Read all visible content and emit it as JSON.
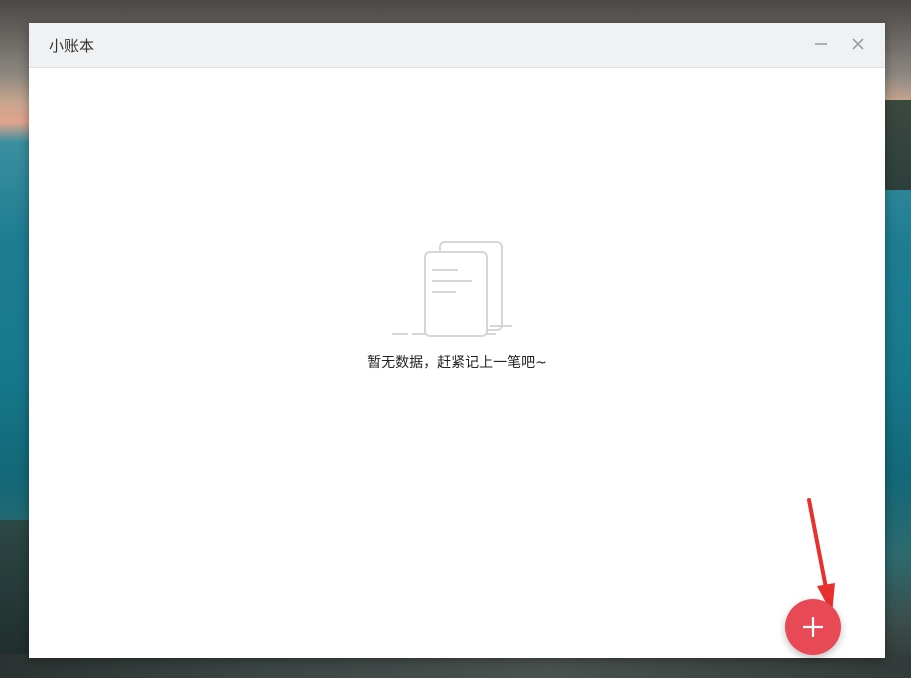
{
  "window": {
    "title": "小账本",
    "minimize_icon": "minimize-icon",
    "close_icon": "close-icon"
  },
  "empty_state": {
    "icon": "empty-documents-icon",
    "message": "暂无数据，赶紧记上一笔吧~"
  },
  "fab": {
    "icon": "plus-icon",
    "color": "#e84a55"
  },
  "annotation": {
    "icon": "red-arrow-annotation",
    "color": "#e8302f"
  }
}
